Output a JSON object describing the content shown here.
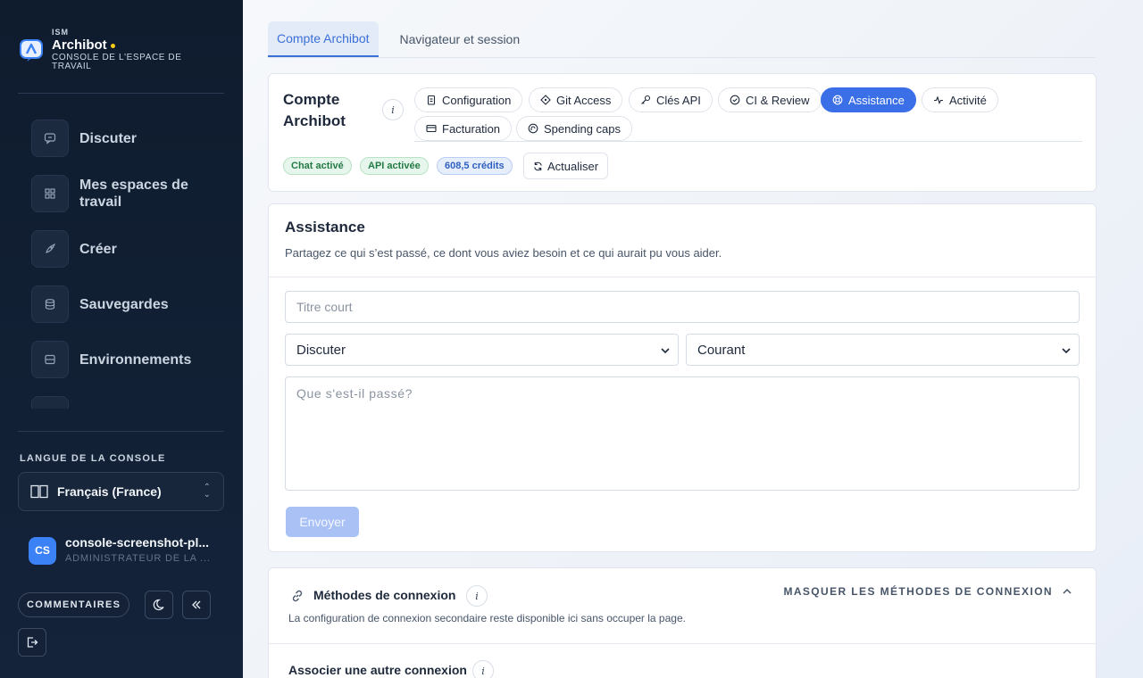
{
  "brand": {
    "kicker": "ISM",
    "name": "Archibot",
    "subtitle": "CONSOLE DE L'ESPACE DE TRAVAIL"
  },
  "nav": {
    "items": [
      {
        "label": "Discuter",
        "icon": "chat-icon"
      },
      {
        "label": "Mes espaces de travail",
        "icon": "grid-icon"
      },
      {
        "label": "Créer",
        "icon": "rocket-icon"
      },
      {
        "label": "Sauvegardes",
        "icon": "database-icon"
      },
      {
        "label": "Environnements",
        "icon": "server-icon"
      }
    ]
  },
  "language": {
    "title": "LANGUE DE LA CONSOLE",
    "selected": "Français (France)"
  },
  "user": {
    "initials": "CS",
    "name": "console-screenshot-pl...",
    "role": "ADMINISTRATEUR DE LA ..."
  },
  "footer": {
    "feedback_label": "COMMENTAIRES"
  },
  "top_tabs": [
    {
      "label": "Compte Archibot",
      "active": true
    },
    {
      "label": "Navigateur et session",
      "active": false
    }
  ],
  "account": {
    "title": "Compte Archibot",
    "info": "i",
    "chips": [
      {
        "label": "Configuration",
        "icon": "clipboard-icon"
      },
      {
        "label": "Git Access",
        "icon": "git-icon"
      },
      {
        "label": "Clés API",
        "icon": "key-icon"
      },
      {
        "label": "CI & Review",
        "icon": "check-circle-icon"
      },
      {
        "label": "Assistance",
        "icon": "lifebuoy-icon",
        "active": true
      },
      {
        "label": "Activité",
        "icon": "activity-icon"
      },
      {
        "label": "Facturation",
        "icon": "card-icon"
      },
      {
        "label": "Spending caps",
        "icon": "gauge-icon"
      }
    ],
    "badges": {
      "chat": "Chat activé",
      "api": "API activée",
      "credits": "608,5 crédits"
    },
    "refresh_label": "Actualiser"
  },
  "assistance": {
    "title": "Assistance",
    "description": "Partagez ce qui s’est passé, ce dont vous aviez besoin et ce qui aurait pu vous aider.",
    "title_placeholder": "Titre court",
    "category_selected": "Discuter",
    "priority_selected": "Courant",
    "body_placeholder": "Que s'est-il passé?",
    "submit_label": "Envoyer"
  },
  "connections": {
    "title": "Méthodes de connexion",
    "description": "La configuration de connexion secondaire reste disponible ici sans occuper la page.",
    "toggle_label": "MASQUER LES MÉTHODES DE CONNEXION",
    "sub_title": "Associer une autre connexion"
  },
  "colors": {
    "sidebar_bg": "#0f1c2e",
    "accent": "#3b6fe8",
    "brand_dot": "#facc15",
    "badge_green": "#237a45",
    "badge_blue": "#2f5fbf"
  }
}
